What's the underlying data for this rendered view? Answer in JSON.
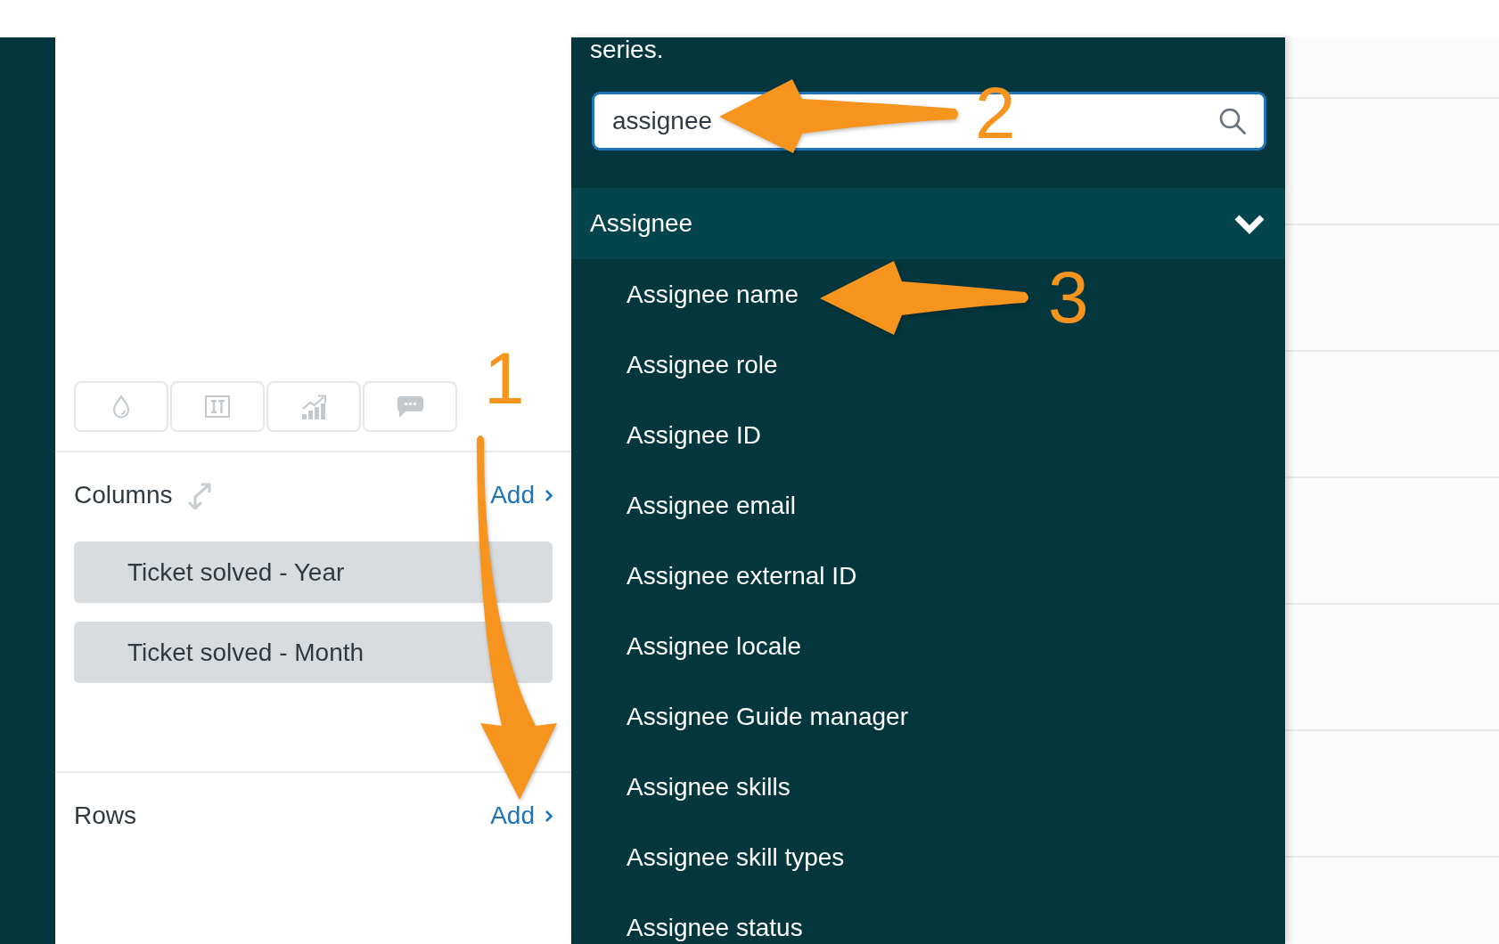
{
  "builder": {
    "toolbar": [
      {
        "kind": "droplet"
      },
      {
        "kind": "pillars"
      },
      {
        "kind": "trend"
      },
      {
        "kind": "comment"
      }
    ],
    "sections": [
      {
        "title": "Columns",
        "swap": true,
        "add_link": "Add",
        "items": [
          {
            "label": "Ticket solved - Year"
          },
          {
            "label": "Ticket solved - Month"
          }
        ]
      },
      {
        "title": "Rows",
        "swap": false,
        "add_link": "Add"
      }
    ]
  },
  "dropdown": {
    "text": "series.",
    "search": {
      "value": "assignee"
    },
    "groups": [
      {
        "title": "Assignee",
        "expanded": true,
        "items": [
          "Assignee name",
          "Assignee role",
          "Assignee ID",
          "Assignee email",
          "Assignee external ID",
          "Assignee locale",
          "Assignee Guide manager",
          "Assignee skills",
          "Assignee skill types",
          "Assignee status"
        ]
      }
    ]
  },
  "annotations": [
    {
      "label": "1"
    },
    {
      "label": "2"
    },
    {
      "label": "3"
    }
  ]
}
